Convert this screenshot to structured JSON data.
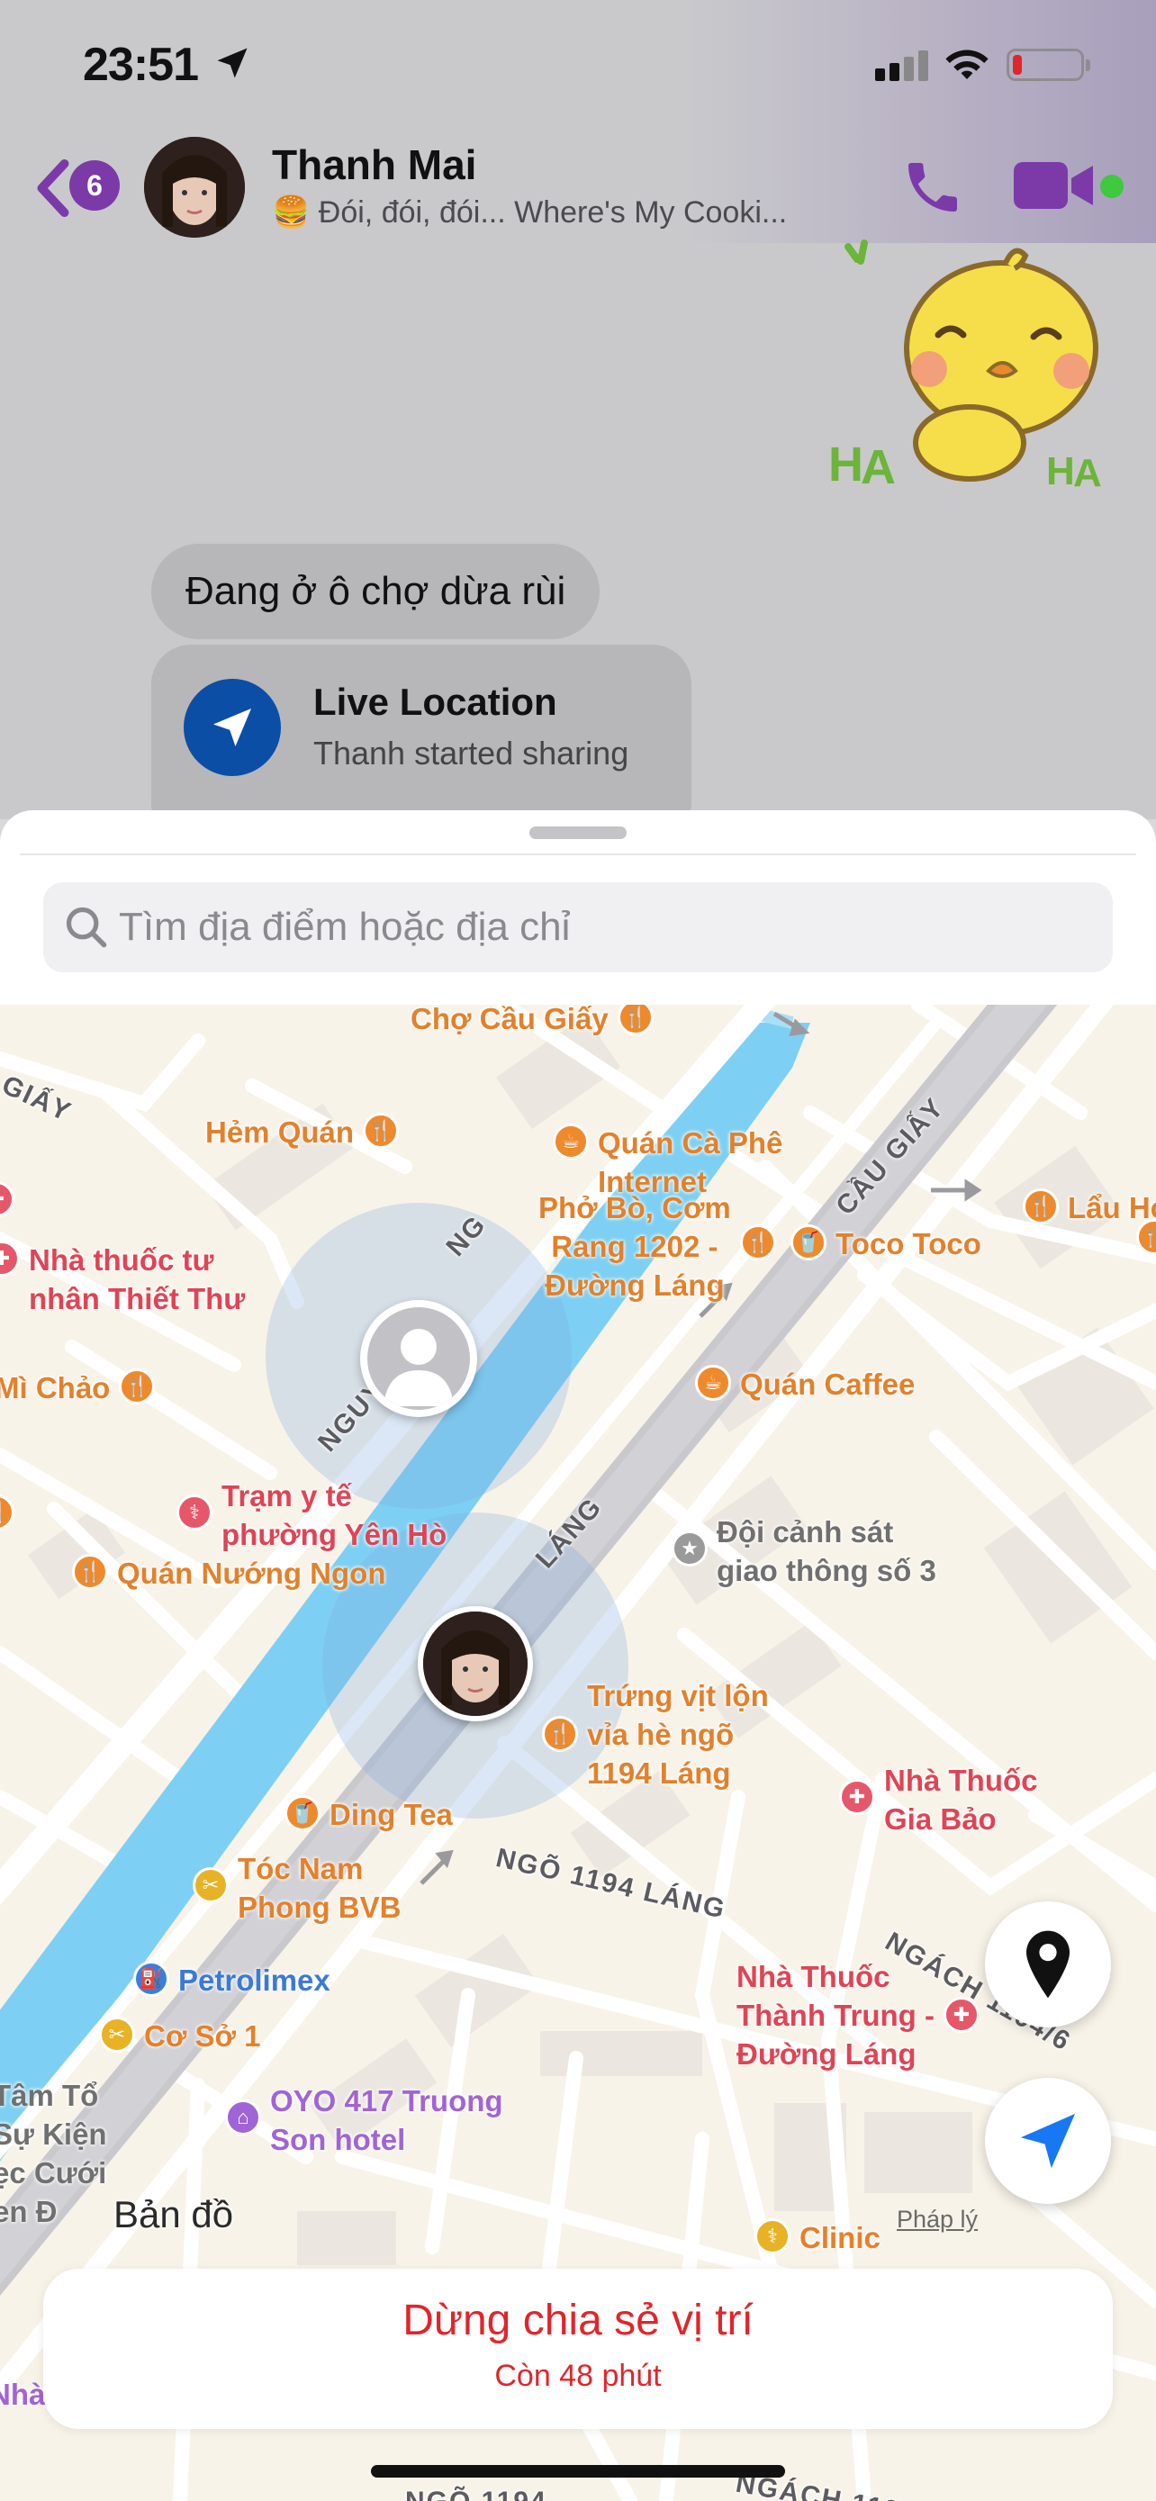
{
  "status_bar": {
    "time": "23:51"
  },
  "header": {
    "unread_count": "6",
    "contact_name": "Thanh Mai",
    "contact_status": "🍔 Đói, đói, đói... Where's My Cooki..."
  },
  "messages": {
    "text_bubble": "Đang ở ô chợ dừa rùi",
    "live_location": {
      "title": "Live Location",
      "subtitle": "Thanh started sharing"
    }
  },
  "search": {
    "placeholder": "Tìm địa điểm hoặc địa chỉ"
  },
  "map": {
    "places": [
      {
        "name": "Chợ Cầu Giấy",
        "style": "orange",
        "icon": "fork-knife-icon"
      },
      {
        "name": "Hẻm Quán",
        "style": "orange",
        "icon": "fork-knife-icon"
      },
      {
        "name": "Quán Cà Phê\nInternet",
        "style": "orange",
        "icon": "coffee-icon"
      },
      {
        "name": "Nhà thuốc tư\nnhân Thiết Thư",
        "style": "red",
        "icon": "pharmacy-icon"
      },
      {
        "name": "Phở Bò, Cơm\nRang 1202 -\nĐường Láng",
        "style": "orange",
        "icon": "fork-knife-icon"
      },
      {
        "name": "Toco Toco",
        "style": "orange",
        "icon": "drink-icon"
      },
      {
        "name": "Lẩu Hơ",
        "style": "orange",
        "icon": "fork-knife-icon"
      },
      {
        "name": "Mì Chảo",
        "style": "orange",
        "icon": "fork-knife-icon"
      },
      {
        "name": "Quán Caffee",
        "style": "orange",
        "icon": "coffee-icon"
      },
      {
        "name": "Trạm y tế\nphường Yên Hò",
        "style": "red",
        "icon": "medical-icon"
      },
      {
        "name": "Đội cảnh sát\ngiao thông số 3",
        "style": "grey",
        "icon": "police-icon"
      },
      {
        "name": "Quán Nướng Ngon",
        "style": "orange",
        "icon": "fork-knife-icon"
      },
      {
        "name": "Trứng vịt lộn\nvỉa hè ngõ\n1194 Láng",
        "style": "orange",
        "icon": "fork-knife-icon"
      },
      {
        "name": "Ding Tea",
        "style": "orange",
        "icon": "drink-icon"
      },
      {
        "name": "Nhà Thuốc\nGia Bảo",
        "style": "red",
        "icon": "pharmacy-icon"
      },
      {
        "name": "Tóc Nam\nPhong BVB",
        "style": "yellow",
        "icon": "salon-icon"
      },
      {
        "name": "Petrolimex",
        "style": "blue",
        "icon": "fuel-icon"
      },
      {
        "name": "Nhà Thuốc\nThành Trung -\nĐường Láng",
        "style": "red",
        "icon": "pharmacy-icon"
      },
      {
        "name": "Cơ Sở 1",
        "style": "yellow",
        "icon": "salon-icon"
      },
      {
        "name": "OYO 417 Truong\nSon hotel",
        "style": "purple",
        "icon": "hotel-icon"
      },
      {
        "name": "Clinic",
        "style": "yellow",
        "icon": "medical-icon"
      },
      {
        "name": "Nhà Nghỉ",
        "style": "purple",
        "icon": "hotel-icon"
      },
      {
        "name": "Tâm Tổ\nSự Kiện\nẹc Cưới\nen Đ",
        "style": "grey",
        "icon": "place-icon"
      }
    ],
    "streets": [
      "CẦU GIẤY",
      "NGUY",
      "NG",
      "LÁNG",
      "NGÕ 1194 LÁNG",
      "NGÁCH 1194/6",
      "GIẤY",
      "NGÕ 1194",
      "NGÁCH 1194/"
    ],
    "brand": "Bản đồ",
    "legal": "Pháp lý"
  },
  "stop_sharing": {
    "title": "Dừng chia sẻ vị trí",
    "remaining": "Còn 48 phút"
  },
  "colors": {
    "accent_purple": "#7c3aa8",
    "danger_red": "#e0262b",
    "live_blue": "#0b4ea6",
    "river": "#7dd0f3"
  }
}
